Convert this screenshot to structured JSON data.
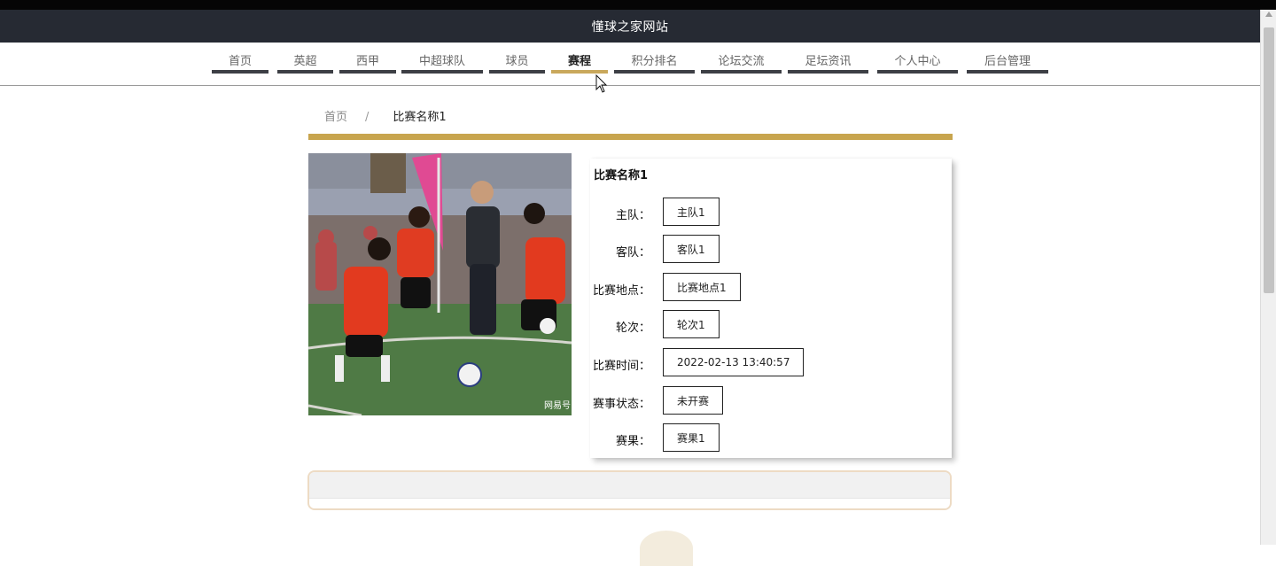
{
  "site": {
    "title": "懂球之家网站"
  },
  "nav": {
    "items": [
      {
        "label": "首页"
      },
      {
        "label": "英超"
      },
      {
        "label": "西甲"
      },
      {
        "label": "中超球队"
      },
      {
        "label": "球员"
      },
      {
        "label": "赛程"
      },
      {
        "label": "积分排名"
      },
      {
        "label": "论坛交流"
      },
      {
        "label": "足坛资讯"
      },
      {
        "label": "个人中心"
      },
      {
        "label": "后台管理"
      }
    ],
    "active_label": "赛程"
  },
  "breadcrumb": {
    "home": "首页",
    "separator": "/",
    "current": "比赛名称1"
  },
  "match": {
    "photo_description": "youth soccer match photo",
    "title": "比赛名称1",
    "fields": [
      {
        "label": "主队：",
        "value": "主队1"
      },
      {
        "label": "客队：",
        "value": "客队1"
      },
      {
        "label": "比赛地点：",
        "value": "比赛地点1"
      },
      {
        "label": "轮次：",
        "value": "轮次1"
      },
      {
        "label": "比赛时间：",
        "value": "2022-02-13 13:40:57"
      },
      {
        "label": "赛事状态：",
        "value": "未开赛"
      },
      {
        "label": "赛果：",
        "value": "赛果1"
      }
    ]
  },
  "colors": {
    "accent": "#c8a54e",
    "header": "#262a33",
    "nav_underline": "#3d3f45"
  },
  "icons": {
    "cursor": "mouse-pointer-icon"
  }
}
